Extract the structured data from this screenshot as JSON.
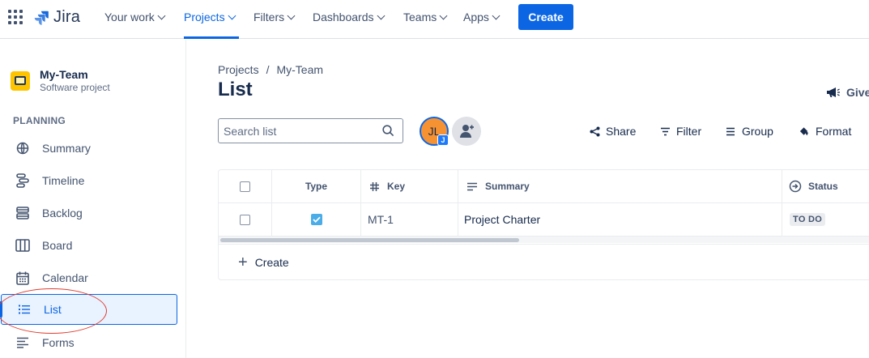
{
  "nav": {
    "logo_text": "Jira",
    "items": [
      {
        "label": "Your work"
      },
      {
        "label": "Projects"
      },
      {
        "label": "Filters"
      },
      {
        "label": "Dashboards"
      },
      {
        "label": "Teams"
      },
      {
        "label": "Apps"
      }
    ],
    "active_item": "Projects",
    "create_label": "Create"
  },
  "sidebar": {
    "project_name": "My-Team",
    "project_type": "Software project",
    "section_title": "PLANNING",
    "items": [
      {
        "label": "Summary",
        "icon": "globe-icon"
      },
      {
        "label": "Timeline",
        "icon": "timeline-icon"
      },
      {
        "label": "Backlog",
        "icon": "backlog-icon"
      },
      {
        "label": "Board",
        "icon": "board-icon"
      },
      {
        "label": "Calendar",
        "icon": "calendar-icon"
      },
      {
        "label": "List",
        "icon": "list-icon",
        "selected": true
      },
      {
        "label": "Forms",
        "icon": "forms-icon"
      }
    ]
  },
  "main": {
    "breadcrumb": [
      "Projects",
      "My-Team"
    ],
    "breadcrumb_sep": "/",
    "title": "List",
    "give_feedback": "Give",
    "search": {
      "placeholder": "Search list",
      "value": ""
    },
    "avatar": {
      "initials": "JL",
      "badge": "J"
    },
    "toolbar": {
      "share": "Share",
      "filter": "Filter",
      "group": "Group",
      "format": "Format"
    },
    "table": {
      "headers": {
        "type": "Type",
        "key": "Key",
        "summary": "Summary",
        "status": "Status"
      },
      "rows": [
        {
          "type_checked": true,
          "key": "MT-1",
          "summary": "Project Charter",
          "status": "TO DO"
        }
      ],
      "create_label": "Create"
    }
  },
  "colors": {
    "brand": "#0c66e4",
    "selected_bg": "#e9f2ff",
    "annotation": "#e03d2f",
    "avatar": "#f79232"
  }
}
